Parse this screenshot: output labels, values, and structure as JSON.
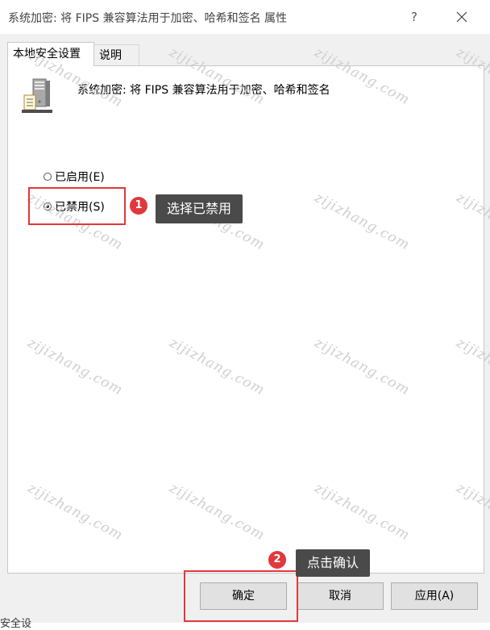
{
  "window": {
    "title": "系统加密: 将 FIPS 兼容算法用于加密、哈希和签名 属性",
    "help_label": "?"
  },
  "tabs": [
    {
      "label": "本地安全设置",
      "active": true
    },
    {
      "label": "说明",
      "active": false
    }
  ],
  "policy": {
    "title": "系统加密: 将 FIPS 兼容算法用于加密、哈希和签名",
    "icon": "server-icon"
  },
  "options": [
    {
      "label": "已启用(E)",
      "checked": false
    },
    {
      "label": "已禁用(S)",
      "checked": true
    }
  ],
  "annotations": [
    {
      "step": "1",
      "text": "选择已禁用"
    },
    {
      "step": "2",
      "text": "点击确认"
    }
  ],
  "buttons": {
    "ok": "确定",
    "cancel": "取消",
    "apply": "应用(A)"
  },
  "watermark": "zijizhang.com",
  "bottom_text": "安全设",
  "colors": {
    "highlight": "#e0383c",
    "tooltip_bg": "#4a4a4a"
  }
}
